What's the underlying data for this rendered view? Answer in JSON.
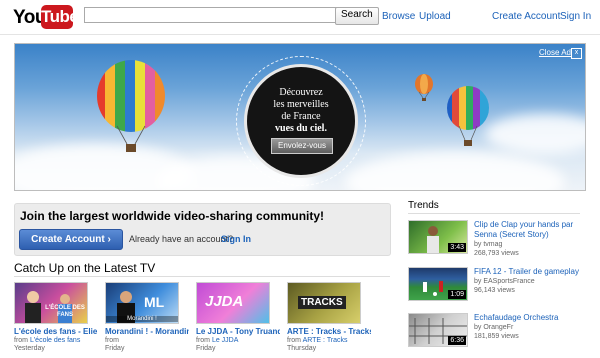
{
  "header": {
    "logo_text_you": "You",
    "logo_text_tube": "Tube",
    "search_button": "Search",
    "search_value": "",
    "nav": {
      "browse": "Browse",
      "upload": "Upload",
      "create_account": "Create Account",
      "sign_in": "Sign In"
    }
  },
  "banner": {
    "close_label": "Close Ad",
    "close_x": "x",
    "line1": "Découvrez",
    "line2": "les merveilles",
    "line3": "de France",
    "line4": "vues du ciel.",
    "button": "Envolez-vous"
  },
  "join": {
    "title": "Join the largest worldwide video-sharing community!",
    "create_button": "Create Account ›",
    "have_account": "Already have an account?",
    "sign_in": "Sign In"
  },
  "catchup": {
    "title": "Catch Up on the Latest TV",
    "from_label": "from",
    "items": [
      {
        "title": "L'école des fans - Elie",
        "from": "L'école des fans",
        "day": "Yesterday"
      },
      {
        "title": "Morandini ! - Morandini du",
        "from": "",
        "day": "Friday"
      },
      {
        "title": "Le JJDA - Tony Truand",
        "from": "Le JJDA",
        "day": "Friday"
      },
      {
        "title": "ARTE : Tracks - Tracks",
        "from": "ARTE : Tracks",
        "day": "Thursday"
      }
    ],
    "thumb_texts": [
      "L'ÉCOLE DES FANS",
      "Morandini !",
      "JJDA",
      "TRACKS"
    ]
  },
  "trends": {
    "title": "Trends",
    "items": [
      {
        "title": "Clip de Clap your hands par Senna (Secret Story)",
        "by": "by tvmag",
        "views": "268,793 views",
        "duration": "3:43"
      },
      {
        "title": "FIFA 12 - Trailer de gameplay",
        "by": "by EASportsFrance",
        "views": "96,143 views",
        "duration": "1:09"
      },
      {
        "title": "Echafaudage Orchestra",
        "by": "by OrangeFr",
        "views": "181,859 views",
        "duration": "6:36"
      }
    ]
  },
  "colors": {
    "brand_red": "#cc181e",
    "link_blue": "#1c62b9",
    "button_blue": "#2e5fb0"
  }
}
